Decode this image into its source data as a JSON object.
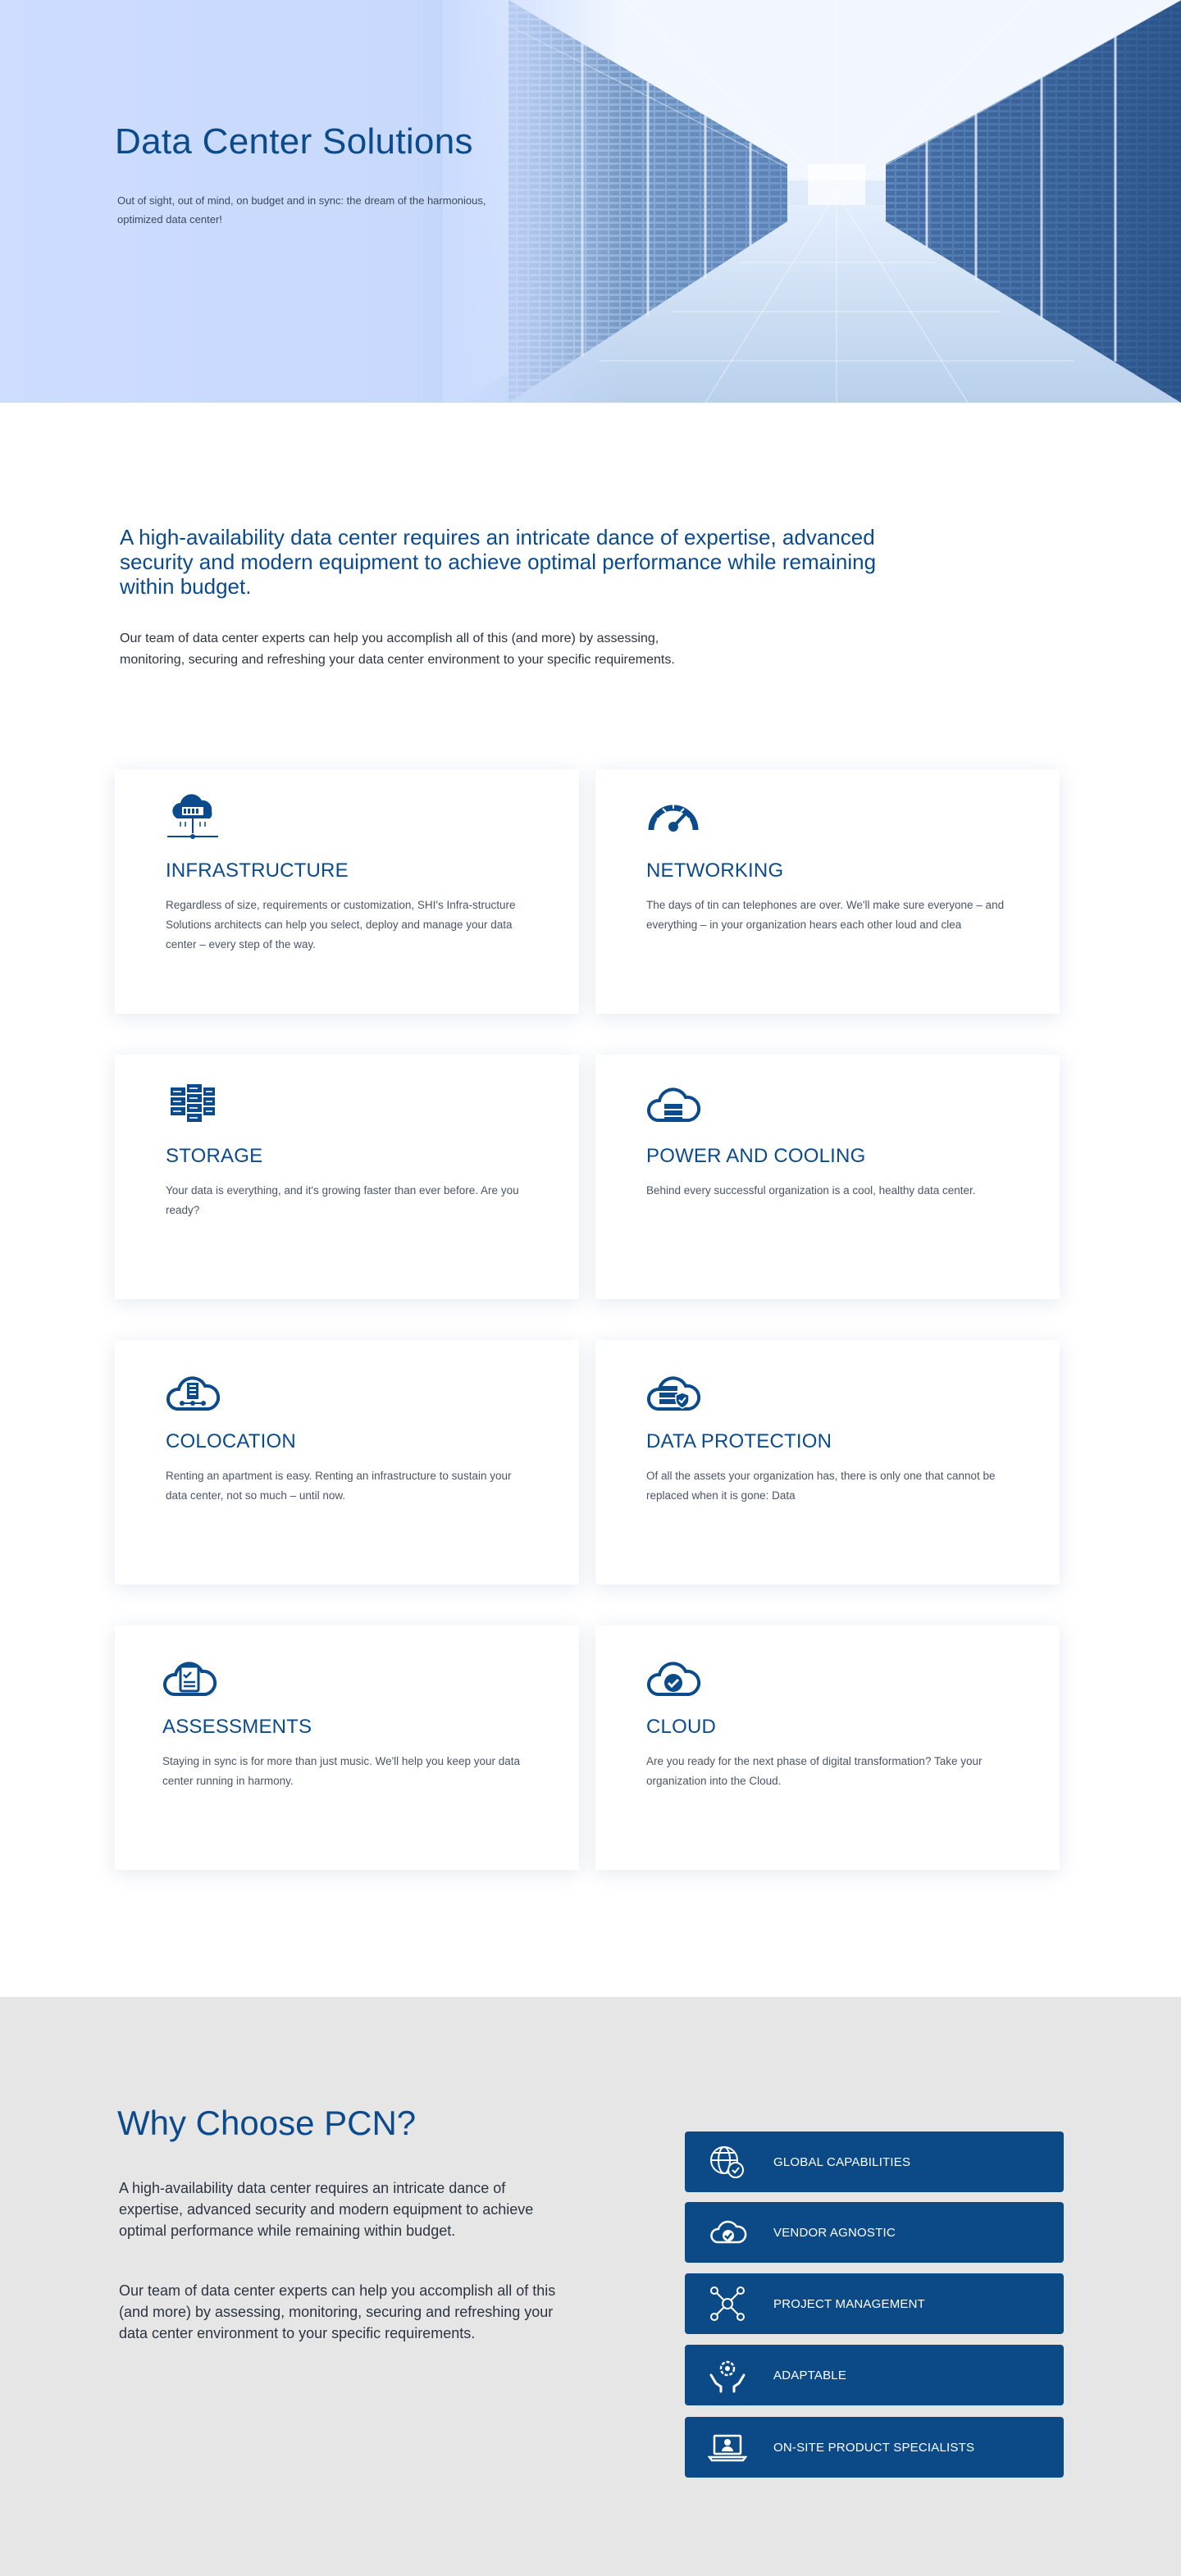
{
  "hero": {
    "title": "Data Center Solutions",
    "subtitle": "Out of sight, out of mind, on budget and in sync: the dream of the harmonious, optimized data center!"
  },
  "intro": {
    "lead": "A high-availability data center requires an intricate dance of expertise, advanced security and modern equipment to achieve optimal performance while remaining within budget.",
    "body": "Our team of data center experts can help you accomplish all of this (and more) by assessing, monitoring, securing and refreshing your data center environment to your specific requirements."
  },
  "services": [
    {
      "title": "INFRASTRUCTURE",
      "icon": "cloud-server-icon",
      "desc": "Regardless of size, requirements or customization, SHI's Infra-structure Solutions architects can help you select, deploy and manage your data center – every step of the way."
    },
    {
      "title": "NETWORKING",
      "icon": "speedometer-icon",
      "desc": "The days of tin can telephones are over. We'll make sure everyone – and everything – in your organization hears each other loud and clea"
    },
    {
      "title": "STORAGE",
      "icon": "server-rack-icon",
      "desc": "Your data is everything, and it's growing faster than ever before. Are you ready?"
    },
    {
      "title": "POWER AND COOLING",
      "icon": "cloud-storage-icon",
      "desc": "Behind every successful organization is a cool, healthy data center."
    },
    {
      "title": "COLOCATION",
      "icon": "cloud-network-icon",
      "desc": "Renting an apartment is easy. Renting an infrastructure to sustain your data center, not so much – until now."
    },
    {
      "title": "DATA PROTECTION",
      "icon": "cloud-shield-icon",
      "desc": "Of all the assets your organization has, there is only one that cannot be replaced when it is gone: Data"
    },
    {
      "title": "ASSESSMENTS",
      "icon": "cloud-checklist-icon",
      "desc": "Staying in sync is for more than just music. We'll help you keep your data center running in harmony."
    },
    {
      "title": "CLOUD",
      "icon": "cloud-check-icon",
      "desc": "Are you ready for the next phase of digital transformation? Take your organization into the Cloud."
    }
  ],
  "why": {
    "title": "Why Choose PCN?",
    "p1": "A high-availability data center requires an intricate dance of expertise, advanced security and modern equipment to achieve optimal performance while remaining within budget.",
    "p2": "Our team of data center experts can help you accomplish all of this (and more) by assessing, monitoring, securing and refreshing your data center environment to your specific requirements.",
    "buttons": [
      {
        "label": "GLOBAL CAPABILITIES",
        "icon": "globe-check-icon"
      },
      {
        "label": "VENDOR AGNOSTIC",
        "icon": "cloud-check-icon"
      },
      {
        "label": "PROJECT MANAGEMENT",
        "icon": "network-people-icon"
      },
      {
        "label": "ADAPTABLE",
        "icon": "hands-gear-icon"
      },
      {
        "label": "ON-SITE PRODUCT SPECIALISTS",
        "icon": "laptop-person-icon"
      }
    ]
  },
  "colors": {
    "brand": "#0b4a8b",
    "button": "#0b4a86",
    "why_bg": "#e6e6e7"
  }
}
